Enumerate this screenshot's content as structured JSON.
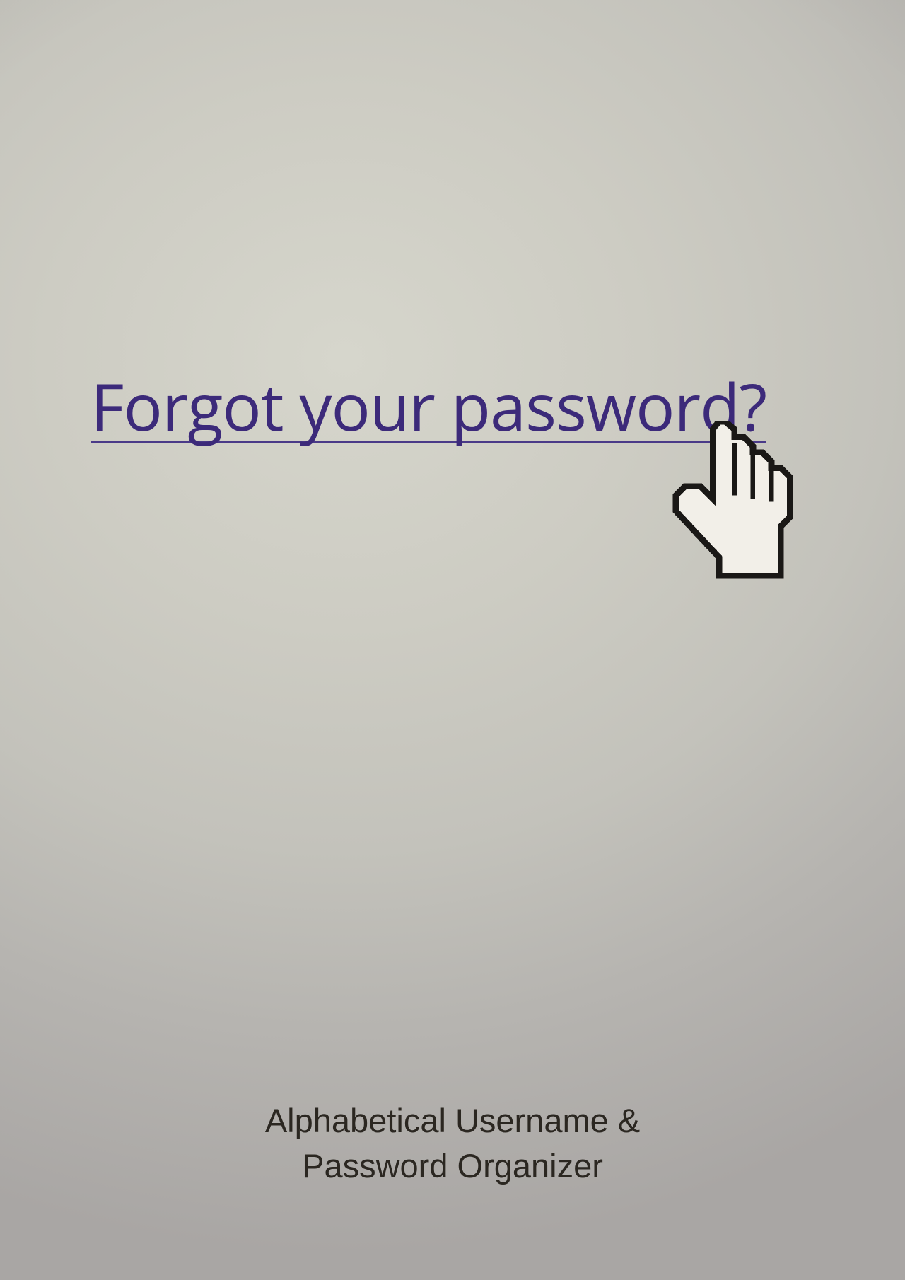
{
  "link": {
    "label": "Forgot your password?"
  },
  "cursor": {
    "name": "pointer-hand-cursor-icon"
  },
  "footer": {
    "line1": "Alphabetical Username &",
    "line2": "Password Organizer"
  },
  "colors": {
    "link": "#3c2a7a",
    "text": "#2b2721"
  }
}
